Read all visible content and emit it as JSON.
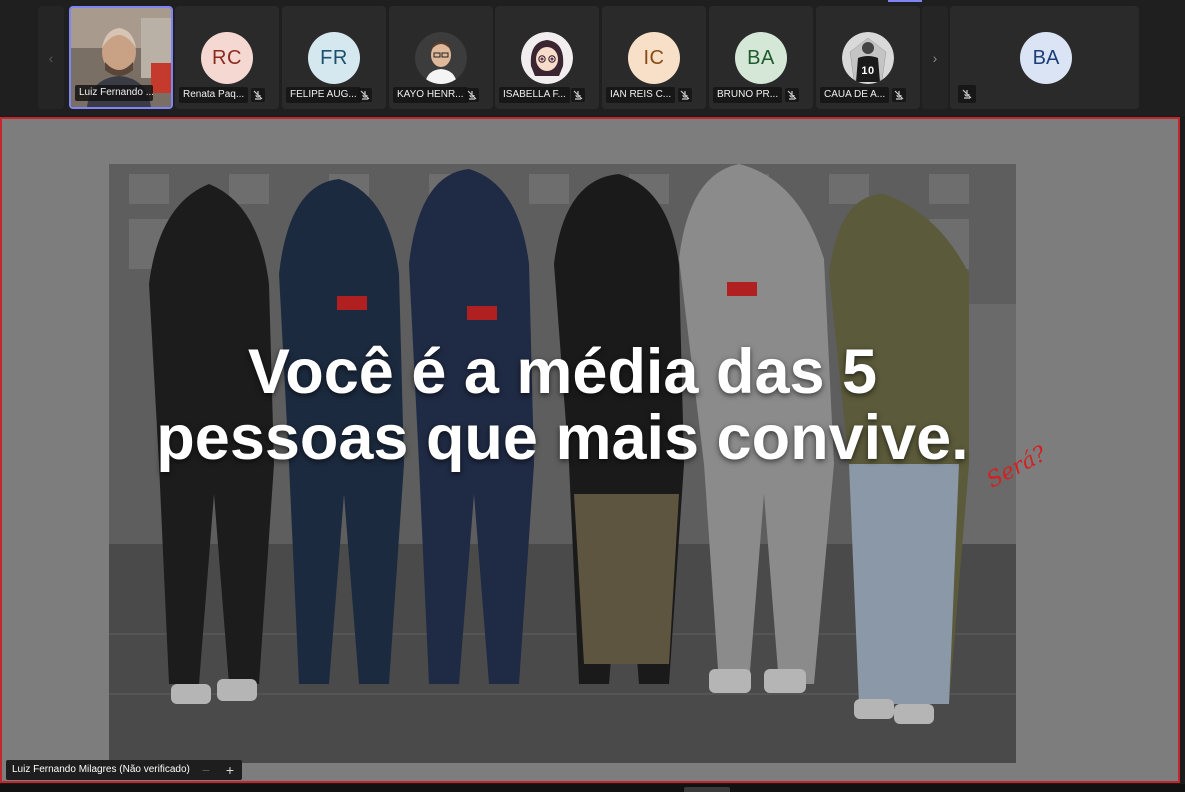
{
  "participants": [
    {
      "name": "Luiz Fernando ...",
      "initials": "",
      "type": "video",
      "active": true
    },
    {
      "name": "Renata Paq...",
      "initials": "RC",
      "type": "initials",
      "bg": "#f6d8d2",
      "fg": "#8a2d1f"
    },
    {
      "name": "FELIPE AUG...",
      "initials": "FR",
      "type": "initials",
      "bg": "#d5e7ef",
      "fg": "#1c4f6b"
    },
    {
      "name": "KAYO HENR...",
      "initials": "",
      "type": "photo",
      "icon": "person-photo-icon"
    },
    {
      "name": "ISABELLA F...",
      "initials": "",
      "type": "photo",
      "icon": "anime-avatar-icon"
    },
    {
      "name": "IAN REIS C...",
      "initials": "IC",
      "type": "initials",
      "bg": "#f7dfc8",
      "fg": "#8a4b12"
    },
    {
      "name": "BRUNO PR...",
      "initials": "BA",
      "type": "initials",
      "bg": "#d5e8d8",
      "fg": "#1f5a2c"
    },
    {
      "name": "CAUA DE A...",
      "initials": "",
      "type": "photo",
      "icon": "jersey-10-icon"
    }
  ],
  "extra_participant": {
    "initials": "BA",
    "bg": "#dbe4f4",
    "fg": "#1b3e78"
  },
  "slide": {
    "line1": "Você é a média das 5",
    "line2": "pessoas que mais convive.",
    "annotation": "Será?"
  },
  "presenter_label": "Luiz Fernando Milagres (Não verificado)",
  "zoom": {
    "minus": "−",
    "plus": "+"
  },
  "nav": {
    "prev": "‹",
    "next": "›"
  },
  "colors": {
    "accent": "#7f85f5",
    "stage_border": "#c4262e",
    "annotation": "#d62020"
  }
}
